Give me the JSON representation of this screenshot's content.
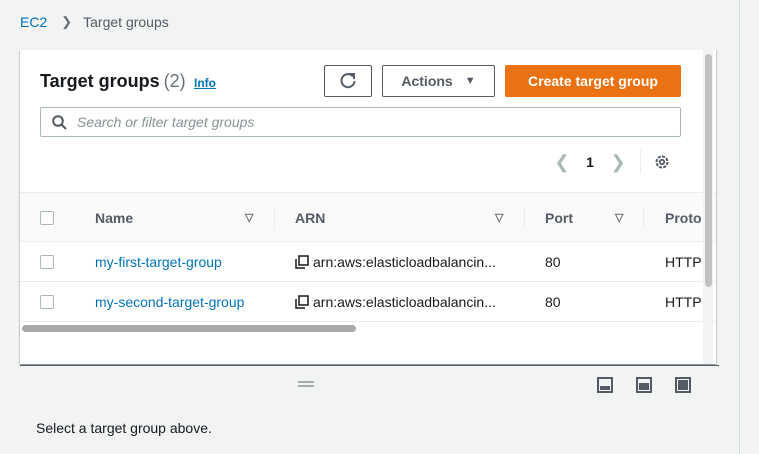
{
  "breadcrumb": {
    "root": "EC2",
    "current": "Target groups"
  },
  "panel": {
    "title": "Target groups",
    "count": "(2)",
    "info": "Info",
    "actions_label": "Actions",
    "create_label": "Create target group",
    "search_placeholder": "Search or filter target groups",
    "page_number": "1"
  },
  "table": {
    "columns": [
      "Name",
      "ARN",
      "Port",
      "Proto"
    ],
    "rows": [
      {
        "name": "my-first-target-group",
        "arn": "arn:aws:elasticloadbalancin...",
        "port": "80",
        "protocol": "HTTP"
      },
      {
        "name": "my-second-target-group",
        "arn": "arn:aws:elasticloadbalancin...",
        "port": "80",
        "protocol": "HTTP"
      }
    ]
  },
  "details": {
    "message": "Select a target group above."
  },
  "colors": {
    "accent": "#ec7211",
    "link": "#0073bb",
    "text": "#16191f"
  },
  "icons": [
    "chevron-right-icon",
    "refresh-icon",
    "caret-down-icon",
    "search-icon",
    "chevron-left-icon",
    "gear-icon",
    "copy-icon",
    "drag-handle-icon",
    "panel-layout-icons"
  ]
}
